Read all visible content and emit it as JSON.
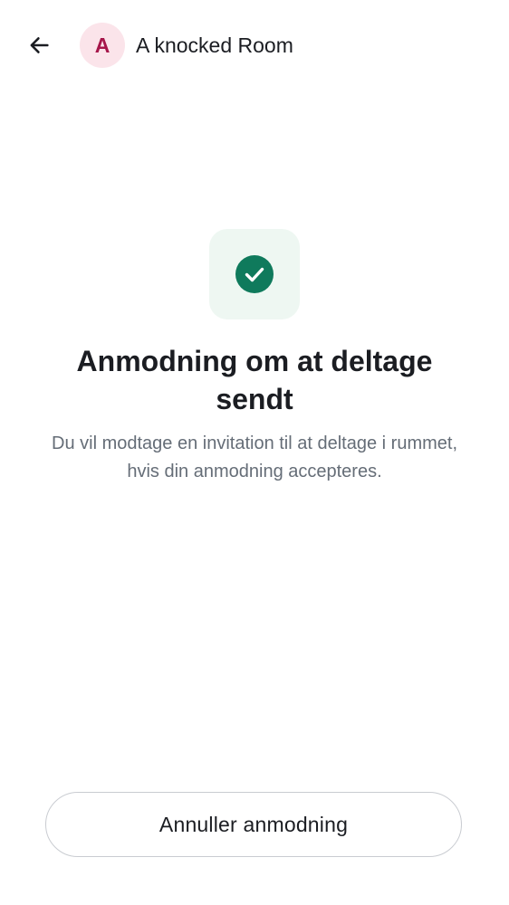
{
  "header": {
    "back_icon": "arrow-left-icon",
    "avatar_initial": "A",
    "room_name": "A knocked Room"
  },
  "status": {
    "icon": "check-circle-icon",
    "title": "Anmodning om at deltage sendt",
    "description": "Du vil modtage en invitation til at deltage i rummet, hvis din anmodning accepteres."
  },
  "actions": {
    "cancel_label": "Annuller anmodning"
  },
  "colors": {
    "avatar_bg": "#fbe4ea",
    "avatar_text": "#a6164a",
    "success": "#0f7a5c",
    "success_tile": "#eef7f2",
    "text_primary": "#1b1d22",
    "text_secondary": "#656d77"
  }
}
